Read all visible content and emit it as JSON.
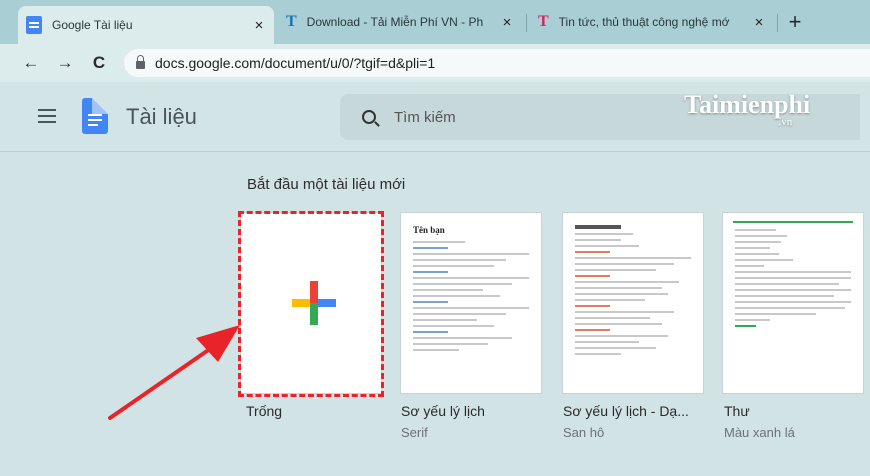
{
  "browser": {
    "tabs": [
      {
        "title": "Google Tài liệu",
        "active": true
      },
      {
        "title": "Download - Tải Miễn Phí VN - Ph",
        "active": false
      },
      {
        "title": "Tin tức, thủ thuật công nghệ mớ",
        "active": false
      }
    ],
    "close_glyph": "×",
    "new_tab_glyph": "+",
    "url": "docs.google.com/document/u/0/?tgif=d&pli=1",
    "back_glyph": "←",
    "forward_glyph": "→",
    "reload_glyph": "C"
  },
  "header": {
    "app_title": "Tài liệu",
    "search_placeholder": "Tìm kiếm",
    "watermark": "Taimienphi",
    "watermark_suffix": ".vn"
  },
  "gallery": {
    "title": "Bắt đầu một tài liệu mới",
    "templates": [
      {
        "name": "Trống",
        "subtitle": ""
      },
      {
        "name": "Sơ yếu lý lịch",
        "subtitle": "Serif"
      },
      {
        "name": "Sơ yếu lý lịch - Dạ...",
        "subtitle": "San hô"
      },
      {
        "name": "Thư",
        "subtitle": "Màu xanh lá"
      }
    ],
    "thumb_heading": "Tên bạn"
  },
  "colors": {
    "highlight": "#e8232a",
    "docs_blue": "#4285f4",
    "plus_red": "#ea4335",
    "plus_yellow": "#fbbc04",
    "plus_green": "#34a853"
  }
}
